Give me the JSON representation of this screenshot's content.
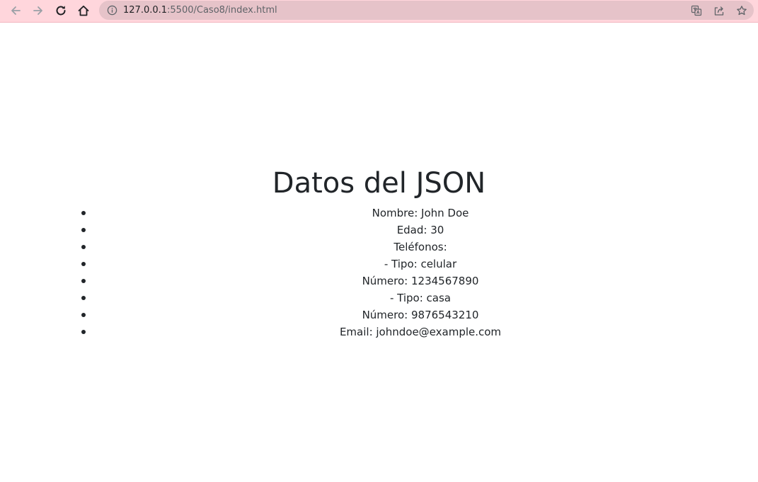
{
  "browser": {
    "url_host": "127.0.0.1",
    "url_path": ":5500/Caso8/index.html",
    "icons": {
      "back": "arrow-left-icon",
      "forward": "arrow-right-icon",
      "reload": "reload-icon",
      "home": "home-icon",
      "site_info": "info-icon",
      "translate": "translate-icon",
      "share": "share-icon",
      "bookmark": "star-icon"
    },
    "colors": {
      "toolbar": "#ffd6dc",
      "omnibox": "#e6c3c9"
    }
  },
  "page": {
    "title": "Datos del JSON",
    "items": [
      "Nombre: John Doe",
      "Edad: 30",
      "Teléfonos:",
      "- Tipo: celular",
      "Número: 1234567890",
      "- Tipo: casa",
      "Número: 9876543210",
      "Email: johndoe@example.com"
    ]
  }
}
